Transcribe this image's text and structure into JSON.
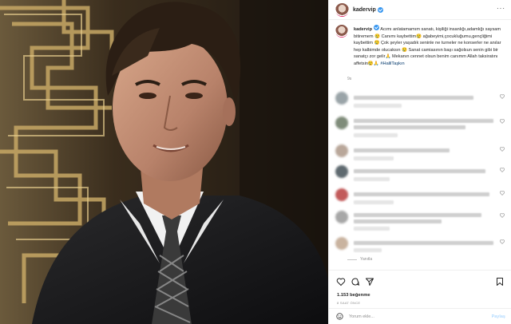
{
  "header": {
    "username": "kadervip",
    "more_icon": "more-dots-icon"
  },
  "caption": {
    "username": "kadervip",
    "text": " Acımı anlatamamım sanatı, kişiliği insanlığı,adamlığı saysam bitiremem 😢 Canımı kaybettim😢 ağabeyimi,çocukluğumu,gençliğimi kaybettim 😢 Çok şeyler yaşadık seninle ne turneler ne konserler ne anılar hep kalbimde olucaksın 😢 Sanat camiasının başı sağolsun senin gibi bir sanatçı zor gelir🙏 Mekanın cennet olsun benim canımm Allah taksiratını affetsin😢🙏 ",
    "hashtag": "#HalilTaşkın",
    "time": "9s"
  },
  "comments": {
    "reply_label": "Yanıtla"
  },
  "actions": {
    "like_icon": "heart-icon",
    "comment_icon": "comment-icon",
    "share_icon": "share-icon",
    "save_icon": "bookmark-icon",
    "likes": "1.153 beğenme",
    "time_ago": "8 SAAT ÖNCE"
  },
  "add_comment": {
    "emoji_icon": "emoji-icon",
    "placeholder": "Yorum ekle...",
    "post_label": "Paylaş"
  },
  "colors": {
    "accent": "#3897f0",
    "hashtag": "#00376b",
    "border": "#efefef"
  }
}
